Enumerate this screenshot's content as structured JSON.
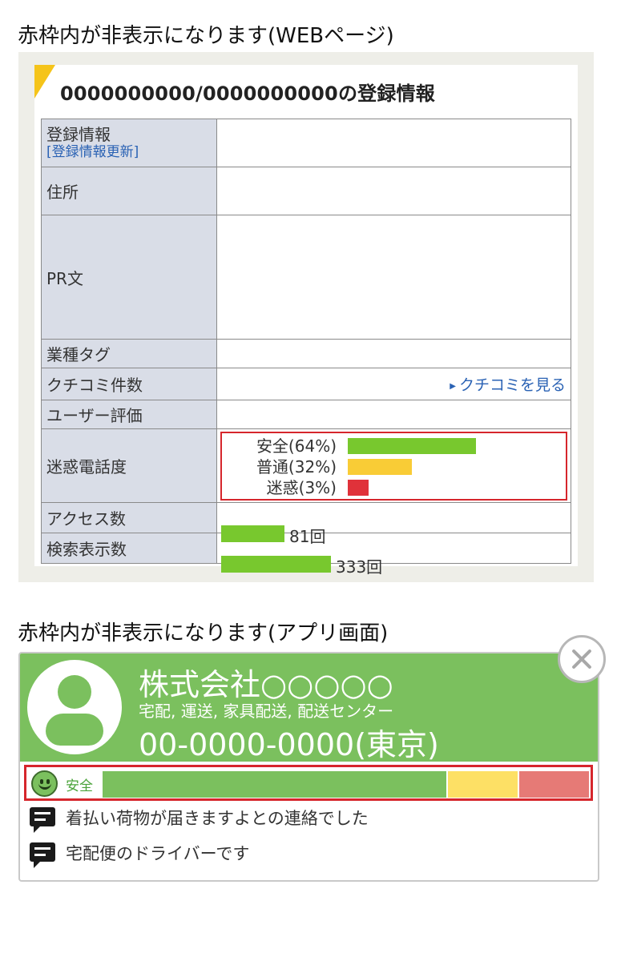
{
  "captions": {
    "web": "赤枠内が非表示になります(WEBページ)",
    "app": "赤枠内が非表示になります(アプリ画面)"
  },
  "web": {
    "title": "0000000000/0000000000の登録情報",
    "rows": {
      "registration": {
        "label": "登録情報",
        "link": "[登録情報更新]"
      },
      "address": {
        "label": "住所"
      },
      "pr": {
        "label": "PR文"
      },
      "industry": {
        "label": "業種タグ"
      },
      "reviews": {
        "label": "クチコミ件数",
        "link": "クチコミを見る"
      },
      "user_rating": {
        "label": "ユーザー評価"
      },
      "nuisance": {
        "label": "迷惑電話度",
        "items": [
          {
            "label": "安全(64%)",
            "percent": 64,
            "color": "#78c82e"
          },
          {
            "label": "普通(32%)",
            "percent": 32,
            "color": "#f9cc36"
          },
          {
            "label": "迷惑(3%)",
            "percent": 3,
            "color": "#e0323a"
          }
        ]
      },
      "access": {
        "label": "アクセス数",
        "value": "81回",
        "count": 81
      },
      "search": {
        "label": "検索表示数",
        "value": "333回",
        "count": 333
      }
    }
  },
  "app": {
    "company_name": "株式会社○○○○○",
    "tags": "宅配, 運送, 家具配送, 配送センター",
    "phone": "00-0000-0000(東京)",
    "safety_label": "安全",
    "safety_segments": [
      {
        "name": "safe",
        "fraction": 0.64,
        "color": "#7bc05e"
      },
      {
        "name": "normal",
        "fraction": 0.13,
        "color": "#fde065"
      },
      {
        "name": "nuisance",
        "fraction": 0.13,
        "color": "#e67a76"
      }
    ],
    "comments": [
      "着払い荷物が届きますよとの連絡でした",
      "宅配便のドライバーです"
    ]
  },
  "icons": [
    "user-avatar-icon",
    "close-icon",
    "smiley-icon",
    "chat-bubble-icon",
    "triangle-right-icon"
  ]
}
